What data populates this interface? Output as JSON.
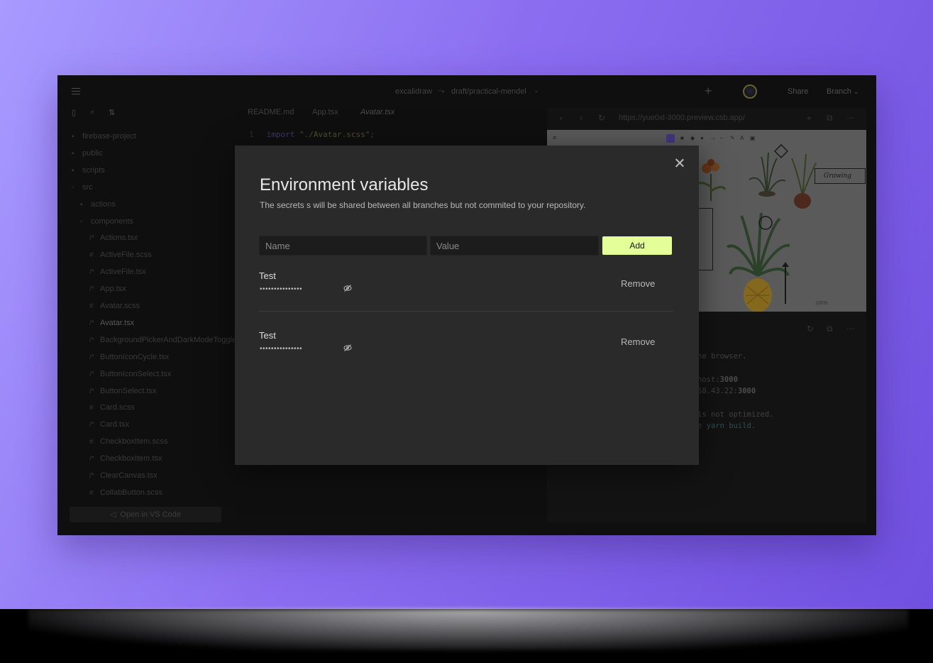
{
  "header": {
    "repo": "excalidraw",
    "branch": "draft/practical-mendel",
    "share_label": "Share",
    "branch_label": "Branch"
  },
  "sidebar": {
    "items": [
      {
        "label": "firebase-project",
        "icon": "folder-icon"
      },
      {
        "label": "public",
        "icon": "folder-icon"
      },
      {
        "label": "scripts",
        "icon": "folder-icon"
      },
      {
        "label": "src",
        "icon": "folder-open-icon"
      },
      {
        "label": "actions",
        "icon": "folder-icon"
      },
      {
        "label": "components",
        "icon": "folder-open-icon"
      },
      {
        "label": "Actions.tsx",
        "icon": "tsx-file-icon"
      },
      {
        "label": "ActiveFile.scss",
        "icon": "scss-file-icon"
      },
      {
        "label": "ActiveFile.tsx",
        "icon": "tsx-file-icon"
      },
      {
        "label": "App.tsx",
        "icon": "tsx-file-icon"
      },
      {
        "label": "Avatar.scss",
        "icon": "scss-file-icon"
      },
      {
        "label": "Avatar.tsx",
        "icon": "tsx-file-icon"
      },
      {
        "label": "BackgroundPickerAndDarkModeToggle",
        "icon": "tsx-file-icon"
      },
      {
        "label": "ButtonIconCycle.tsx",
        "icon": "tsx-file-icon"
      },
      {
        "label": "ButtonIconSelect.tsx",
        "icon": "tsx-file-icon"
      },
      {
        "label": "ButtonSelect.tsx",
        "icon": "tsx-file-icon"
      },
      {
        "label": "Card.scss",
        "icon": "scss-file-icon"
      },
      {
        "label": "Card.tsx",
        "icon": "tsx-file-icon"
      },
      {
        "label": "CheckboxItem.scss",
        "icon": "scss-file-icon"
      },
      {
        "label": "CheckboxItem.tsx",
        "icon": "tsx-file-icon"
      },
      {
        "label": "ClearCanvas.tsx",
        "icon": "tsx-file-icon"
      },
      {
        "label": "CollabButton.scss",
        "icon": "scss-file-icon"
      }
    ],
    "vscode_label": "Open in VS Code"
  },
  "editor": {
    "tabs": [
      "README.md",
      "App.tsx",
      "Avatar.tsx"
    ],
    "line_number": "1",
    "code_keyword": "import",
    "code_string": "\"./Avatar.scss\"",
    "code_punct": ";"
  },
  "preview": {
    "url": "https://yue0xl-3000.preview.csb.app/",
    "canvas_label": "Growing",
    "zoom": "100%",
    "console": {
      "line1": "he browser.",
      "line2a": "host:",
      "line2b": "3000",
      "line3a": "68.43.22:",
      "line3b": "3000",
      "line4": "is not optimized.",
      "line5a": "e ",
      "line5b": "yarn build",
      "line5c": "."
    }
  },
  "modal": {
    "title": "Environment variables",
    "subtitle": "The secrets s will be shared between all branches but not commited to your repository.",
    "name_placeholder": "Name",
    "value_placeholder": "Value",
    "add_label": "Add",
    "remove_label": "Remove",
    "variables": [
      {
        "name": "Test",
        "masked": "•••••••••••••••"
      },
      {
        "name": "Test",
        "masked": "•••••••••••••••"
      }
    ]
  },
  "colors": {
    "accent": "#e4ff97",
    "background_start": "#a89aff",
    "background_end": "#7050e0",
    "modal_bg": "#2a2a2a"
  }
}
